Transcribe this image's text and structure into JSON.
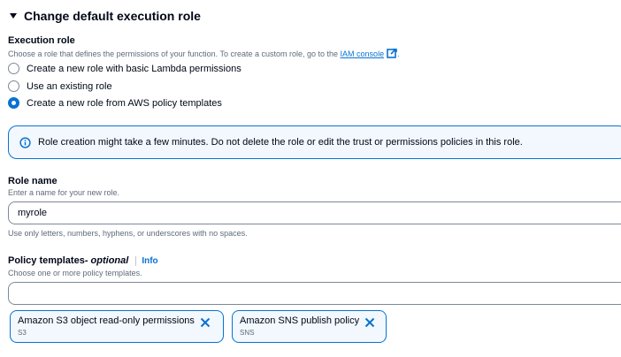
{
  "section": {
    "title": "Change default execution role"
  },
  "execution_role": {
    "label": "Execution role",
    "description_prefix": "Choose a role that defines the permissions of your function. To create a custom role, go to the ",
    "description_link": "IAM console",
    "description_suffix": ".",
    "options": [
      {
        "label": "Create a new role with basic Lambda permissions",
        "checked": false
      },
      {
        "label": "Use an existing role",
        "checked": false
      },
      {
        "label": "Create a new role from AWS policy templates",
        "checked": true
      }
    ]
  },
  "info_alert": {
    "text": "Role creation might take a few minutes. Do not delete the role or edit the trust or permissions policies in this role."
  },
  "role_name": {
    "label": "Role name",
    "description": "Enter a name for your new role.",
    "value": "myrole",
    "constraint": "Use only letters, numbers, hyphens, or underscores with no spaces."
  },
  "policy_templates": {
    "label": "Policy templates",
    "label_optional": " - optional",
    "info_link": "Info",
    "description": "Choose one or more policy templates.",
    "value": "",
    "tokens": [
      {
        "title": "Amazon S3 object read-only permissions",
        "subtitle": "S3"
      },
      {
        "title": "Amazon SNS publish policy",
        "subtitle": "SNS"
      }
    ]
  },
  "colors": {
    "accent": "#0972d3",
    "text": "#000716",
    "secondary": "#5f6b7a",
    "info_bg": "#f2f8fd"
  }
}
